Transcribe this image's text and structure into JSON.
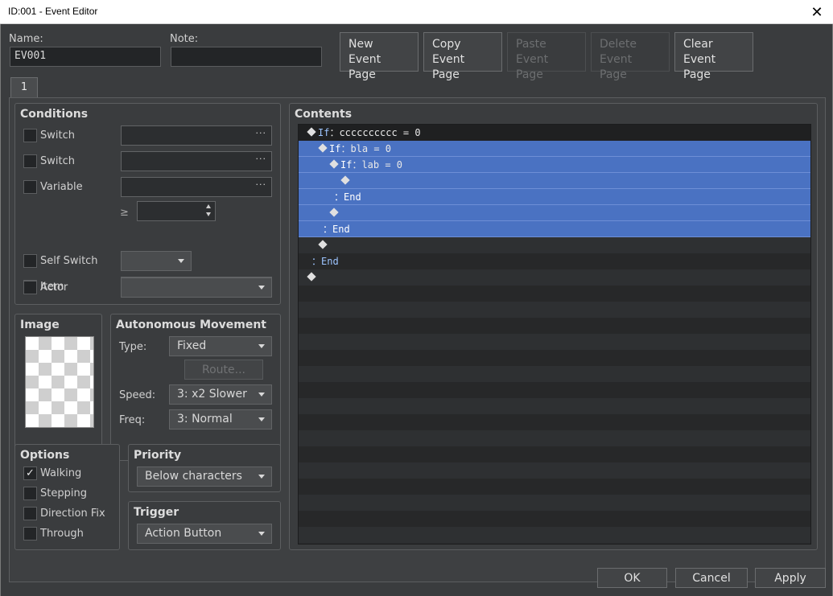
{
  "window": {
    "title": "ID:001 - Event Editor",
    "close_glyph": "✕"
  },
  "header": {
    "name_label": "Name:",
    "name_value": "EV001",
    "note_label": "Note:",
    "note_value": ""
  },
  "page_buttons": {
    "new": [
      "New",
      "Event Page"
    ],
    "copy": [
      "Copy",
      "Event Page"
    ],
    "paste": [
      "Paste",
      "Event Page"
    ],
    "delete": [
      "Delete",
      "Event Page"
    ],
    "clear": [
      "Clear",
      "Event Page"
    ]
  },
  "tabs": [
    "1"
  ],
  "conditions": {
    "title": "Conditions",
    "switch1_label": "Switch",
    "switch2_label": "Switch",
    "variable_label": "Variable",
    "gte_symbol": "≥",
    "self_switch_label": "Self Switch",
    "item_label": "Item",
    "actor_label": "Actor",
    "dots": "···"
  },
  "image": {
    "title": "Image"
  },
  "autonomous": {
    "title": "Autonomous Movement",
    "type_label": "Type:",
    "type_value": "Fixed",
    "route_button": "Route...",
    "speed_label": "Speed:",
    "speed_value": "3: x2 Slower",
    "freq_label": "Freq:",
    "freq_value": "3: Normal"
  },
  "options": {
    "title": "Options",
    "items": [
      {
        "label": "Walking",
        "checked": true,
        "mark": "✓"
      },
      {
        "label": "Stepping",
        "checked": false,
        "mark": ""
      },
      {
        "label": "Direction Fix",
        "checked": false,
        "mark": ""
      },
      {
        "label": "Through",
        "checked": false,
        "mark": ""
      }
    ]
  },
  "priority": {
    "title": "Priority",
    "value": "Below characters"
  },
  "trigger": {
    "title": "Trigger",
    "value": "Action Button"
  },
  "contents": {
    "title": "Contents",
    "lines": [
      {
        "indent": 0,
        "kw": "If",
        "text": "：cccccccccc = 0"
      },
      {
        "indent": 1,
        "kw": "If",
        "text": "：bla = 0"
      },
      {
        "indent": 2,
        "kw": "If",
        "text": "：lab = 0"
      },
      {
        "indent": 3,
        "kw": "",
        "text": ""
      },
      {
        "indent": 2,
        "kw": "",
        "text": "：End"
      },
      {
        "indent": 2,
        "kw": "",
        "text": ""
      },
      {
        "indent": 1,
        "kw": "",
        "text": "：End"
      },
      {
        "indent": 1,
        "kw": "",
        "text": ""
      },
      {
        "indent": 0,
        "kw": "",
        "text": "：End"
      },
      {
        "indent": 0,
        "kw": "",
        "text": ""
      }
    ]
  },
  "footer": {
    "ok": "OK",
    "cancel": "Cancel",
    "apply": "Apply"
  }
}
